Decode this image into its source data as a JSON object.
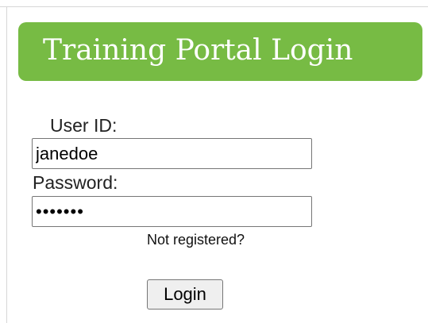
{
  "header": {
    "title": "Training Portal Login"
  },
  "form": {
    "userid_label": "User ID:",
    "userid_value": "janedoe",
    "password_label": "Password:",
    "password_value": "•••••••",
    "register_link": "Not registered?",
    "login_button": "Login"
  },
  "colors": {
    "title_bar": "#77bb44",
    "title_text": "#ffffff"
  }
}
